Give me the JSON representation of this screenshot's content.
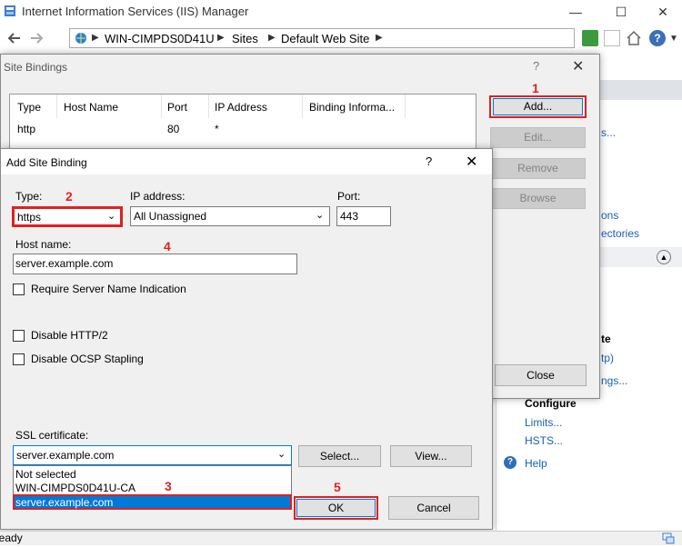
{
  "window": {
    "title": "Internet Information Services (IIS) Manager"
  },
  "address": {
    "crumbs": [
      "WIN-CIMPDS0D41U",
      "Sites",
      "Default Web Site"
    ]
  },
  "site_bindings": {
    "title": "Site Bindings",
    "help": "?",
    "columns": [
      "Type",
      "Host Name",
      "Port",
      "IP Address",
      "Binding Informa..."
    ],
    "row": {
      "type": "http",
      "host": "",
      "port": "80",
      "ip": "*",
      "info": ""
    },
    "buttons": {
      "add": "Add...",
      "edit": "Edit...",
      "remove": "Remove",
      "browse": "Browse",
      "close": "Close"
    }
  },
  "right_panel": {
    "frag1": "s...",
    "frag2": "ons",
    "frag3": "ectories",
    "frag4": "te",
    "frag5": "tp)",
    "frag6": "ngs...",
    "configure_heading": "Configure",
    "limits": "Limits...",
    "hsts": "HSTS...",
    "help": "Help"
  },
  "add_binding": {
    "title": "Add Site Binding",
    "help": "?",
    "type_label": "Type:",
    "type_value": "https",
    "ip_label": "IP address:",
    "ip_value": "All Unassigned",
    "port_label": "Port:",
    "port_value": "443",
    "host_label": "Host name:",
    "host_value": "server.example.com",
    "sni_label": "Require Server Name Indication",
    "http2_label": "Disable HTTP/2",
    "ocsp_label": "Disable OCSP Stapling",
    "ssl_label": "SSL certificate:",
    "ssl_value": "server.example.com",
    "ssl_options": [
      "Not selected",
      "WIN-CIMPDS0D41U-CA",
      "server.example.com"
    ],
    "select_btn": "Select...",
    "view_btn": "View...",
    "ok_btn": "OK",
    "cancel_btn": "Cancel"
  },
  "status": {
    "text": "Ready"
  },
  "annotations": {
    "n1": "1",
    "n2": "2",
    "n3": "3",
    "n4": "4",
    "n5": "5"
  },
  "colors": {
    "highlight": "#e02020",
    "selection": "#0078d7",
    "link": "#1a5fb4"
  }
}
